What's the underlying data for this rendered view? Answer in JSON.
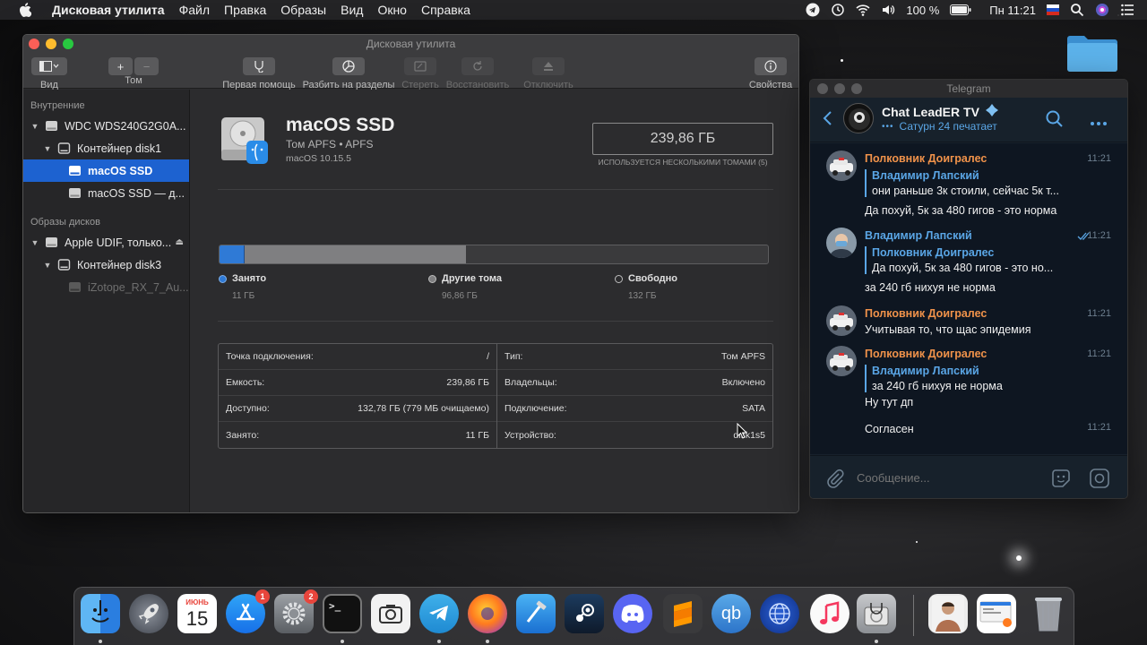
{
  "menubar": {
    "app": "Дисковая утилита",
    "items": [
      "Файл",
      "Правка",
      "Образы",
      "Вид",
      "Окно",
      "Справка"
    ],
    "battery": "100 %",
    "datetime": "Пн 11:21"
  },
  "disk_utility": {
    "title": "Дисковая утилита",
    "toolbar": {
      "view": "Вид",
      "volume": "Том",
      "first_aid": "Первая помощь",
      "partition": "Разбить на разделы",
      "erase": "Стереть",
      "restore": "Восстановить",
      "unmount": "Отключить",
      "info": "Свойства"
    },
    "sidebar": {
      "internal_header": "Внутренние",
      "images_header": "Образы дисков",
      "items": [
        {
          "label": "WDC WDS240G2G0A..."
        },
        {
          "label": "Контейнер disk1"
        },
        {
          "label": "macOS SSD"
        },
        {
          "label": "macOS SSD — д..."
        },
        {
          "label": "Apple UDIF, только..."
        },
        {
          "label": "Контейнер disk3"
        },
        {
          "label": "iZotope_RX_7_Au..."
        }
      ]
    },
    "volume": {
      "name": "macOS SSD",
      "subtitle": "Том APFS • APFS",
      "os": "macOS 10.15.5",
      "capacity": "239,86 ГБ",
      "capacity_note": "ИСПОЛЬЗУЕТСЯ НЕСКОЛЬКИМИ ТОМАМИ (5)"
    },
    "usage": {
      "used_label": "Занято",
      "used_value": "11 ГБ",
      "used_fraction": 0.0459,
      "other_label": "Другие тома",
      "other_value": "96,86 ГБ",
      "other_fraction": 0.4038,
      "free_label": "Свободно",
      "free_value": "132 ГБ",
      "used_color": "#2f7ad6",
      "other_color": "#7f7f81"
    },
    "info": {
      "left": [
        {
          "k": "Точка подключения:",
          "v": "/"
        },
        {
          "k": "Емкость:",
          "v": "239,86 ГБ"
        },
        {
          "k": "Доступно:",
          "v": "132,78 ГБ (779 МБ очищаемо)"
        },
        {
          "k": "Занято:",
          "v": "11 ГБ"
        }
      ],
      "right": [
        {
          "k": "Тип:",
          "v": "Том APFS"
        },
        {
          "k": "Владельцы:",
          "v": "Включено"
        },
        {
          "k": "Подключение:",
          "v": "SATA"
        },
        {
          "k": "Устройство:",
          "v": "disk1s5"
        }
      ]
    }
  },
  "telegram": {
    "title": "Telegram",
    "chat_name": "Chat LeadER TV",
    "status": "Сатурн 24 печатает",
    "composer_placeholder": "Сообщение...",
    "messages": [
      {
        "name": "Полковник Доигралес",
        "time": "11:21",
        "quote_name": "Владимир Лапский",
        "quote_text": "они раньше 3к стоили, сейчас 5к т...",
        "text": "Да похуй, 5к за 480 гигов - это норма"
      },
      {
        "name": "Владимир Лапский",
        "time": "11:21",
        "quote_name": "Полковник Доигралес",
        "quote_text": "Да похуй, 5к за 480 гигов - это но...",
        "text": "за 240 гб нихуя не норма"
      },
      {
        "name": "Полковник Доигралес",
        "time": "11:21",
        "text": "Учитывая то, что щас эпидемия"
      },
      {
        "name": "Полковник Доигралес",
        "time": "11:21",
        "quote_name": "Владимир Лапский",
        "quote_text": "за 240 гб нихуя не норма",
        "text": "Ну тут дп"
      },
      {
        "time": "11:21",
        "text": "Согласен"
      }
    ],
    "colors": {
      "orange_name": "#f0924a",
      "blue_name": "#5aa6e6"
    }
  },
  "dock": {
    "calendar_month": "ИЮНЬ",
    "calendar_day": "15",
    "appstore_badge": "1",
    "prefs_badge": "2",
    "qb_label": "qb"
  }
}
